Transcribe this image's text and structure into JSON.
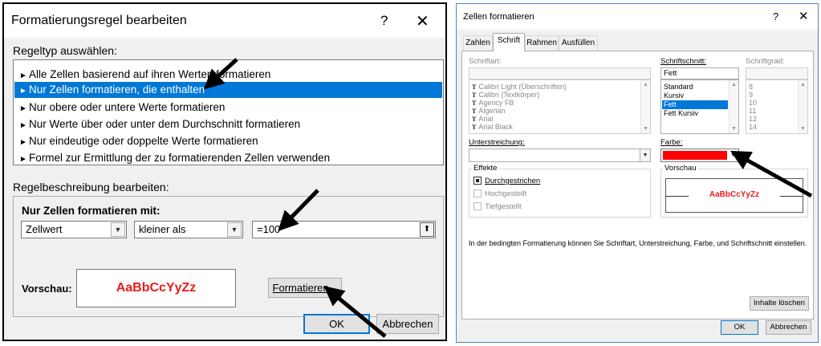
{
  "left_dialog": {
    "title": "Formatierungsregel bearbeiten",
    "help": "?",
    "close": "✕",
    "rule_type_label": "Regeltyp auswählen:",
    "rule_types": [
      "Alle Zellen basierend auf ihren Werten formatieren",
      "Nur Zellen formatieren, die enthalten",
      "Nur obere oder untere Werte formatieren",
      "Nur Werte über oder unter dem Durchschnitt formatieren",
      "Nur eindeutige oder doppelte Werte formatieren",
      "Formel zur Ermittlung der zu formatierenden Zellen verwenden"
    ],
    "selected_rule_index": 1,
    "description_label": "Regelbeschreibung bearbeiten:",
    "format_only_label": "Nur Zellen formatieren mit:",
    "field_type": "Zellwert",
    "operator": "kleiner als",
    "value": "=100",
    "preview_label": "Vorschau:",
    "preview_text": "AaBbCcYyZz",
    "format_button": "Formatieren...",
    "ok": "OK",
    "cancel": "Abbrechen"
  },
  "right_dialog": {
    "title": "Zellen formatieren",
    "help": "?",
    "close": "✕",
    "tabs": [
      "Zahlen",
      "Schrift",
      "Rahmen",
      "Ausfüllen"
    ],
    "active_tab": "Schrift",
    "font_label": "Schriftart:",
    "font_value": "",
    "fonts": [
      "Calibri Light (Überschriften)",
      "Calibri (Textkörper)",
      "Agency FB",
      "Algerian",
      "Arial",
      "Arial Black"
    ],
    "style_label": "Schriftschnitt:",
    "style_value": "Fett",
    "styles": [
      "Standard",
      "Kursiv",
      "Fett",
      "Fett Kursiv"
    ],
    "selected_style": "Fett",
    "size_label": "Schriftgrad:",
    "size_value": "",
    "sizes": [
      "8",
      "9",
      "10",
      "11",
      "12",
      "14"
    ],
    "underline_label": "Unterstreichung:",
    "underline_value": "",
    "color_label": "Farbe:",
    "color_value": "#ff0000",
    "effects_label": "Effekte",
    "effects": [
      {
        "label": "Durchgestrichen",
        "checked": true,
        "enabled": true
      },
      {
        "label": "Hochgestellt",
        "checked": false,
        "enabled": false
      },
      {
        "label": "Tiefgestellt",
        "checked": false,
        "enabled": false
      }
    ],
    "preview_label": "Vorschau",
    "preview_text": "AaBbCcYyZz",
    "info_text": "In der bedingten Formatierung können Sie Schriftart, Unterstreichung, Farbe, und Schriftschnitt einstellen.",
    "clear_button": "Inhalte löschen",
    "ok": "OK",
    "cancel": "Abbrechen"
  },
  "colors": {
    "selection": "#0078d7",
    "preview_red": "#e81d1d",
    "color_swatch": "#ff0000",
    "arrow": "#000000"
  }
}
